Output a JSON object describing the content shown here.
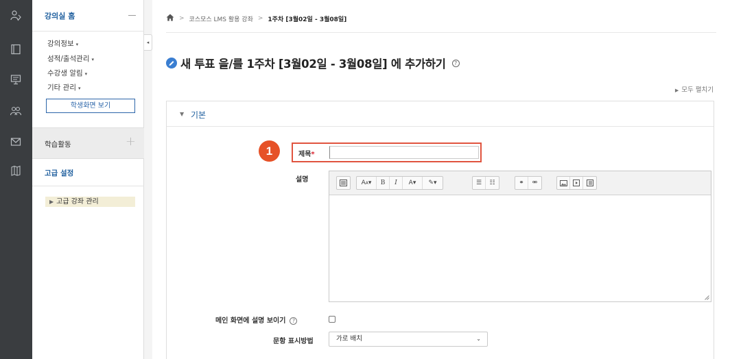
{
  "sidebar": {
    "home_title": "강의실 홈",
    "menu": [
      {
        "label": "강의정보",
        "caret": "▾"
      },
      {
        "label": "성적/출석관리",
        "caret": "▾"
      },
      {
        "label": "수강생 알림",
        "caret": "▾"
      },
      {
        "label": "기타 관리",
        "caret": "▾"
      }
    ],
    "student_view_button": "학생화면 보기",
    "activity_label": "학습활동",
    "activity_add": "+",
    "advanced_settings": "고급 설정",
    "course_admin": "고급 강좌 관리",
    "icons": [
      "people-icon",
      "book-icon",
      "presentation-icon",
      "group-icon",
      "mail-icon",
      "library-icon"
    ]
  },
  "collapse_toggle": "◂",
  "breadcrumb": {
    "items": [
      "코스모스 LMS 활용 강좌",
      "1주차 [3월02일 - 3월08일]"
    ],
    "separator": ">"
  },
  "page": {
    "title": "새 투표 을/를 1주차 [3월02일 - 3월08일] 에 추가하기",
    "help": "?",
    "expand_all": "모두 펼치기"
  },
  "section": {
    "label": "기본"
  },
  "form": {
    "title_label": "제목",
    "required_mark": "*",
    "title_value": "",
    "callout_number": "1",
    "description_label": "설명",
    "show_description_label": "메인 화면에 설명 보이기",
    "help": "?",
    "option_display_label": "문항 표시방법",
    "option_display_value": "가로 배치"
  },
  "colors": {
    "rail": "#3a3d40",
    "link_blue": "#1f5f9e",
    "highlight_red": "#e0533e",
    "callout_orange": "#e65127"
  }
}
